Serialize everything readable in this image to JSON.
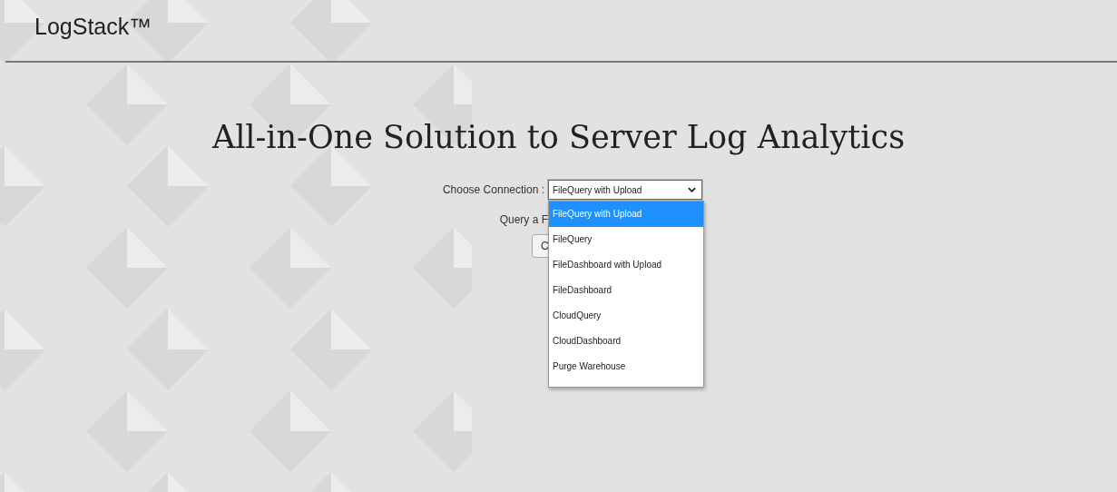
{
  "header": {
    "logo": "LogStack™"
  },
  "title": "All-in-One Solution to Server Log Analytics",
  "connection": {
    "label": "Choose Connection :",
    "value": "FileQuery with Upload",
    "expanded": true,
    "options": [
      {
        "label": "FileQuery with Upload",
        "selected": true
      },
      {
        "label": "FileQuery",
        "selected": false
      },
      {
        "label": "FileDashboard with Upload",
        "selected": false
      },
      {
        "label": "FileDashboard",
        "selected": false
      },
      {
        "label": "CloudQuery",
        "selected": false
      },
      {
        "label": "CloudDashboard",
        "selected": false
      },
      {
        "label": "Purge Warehouse",
        "selected": false
      }
    ]
  },
  "query_label": "Query a F",
  "button": "C"
}
